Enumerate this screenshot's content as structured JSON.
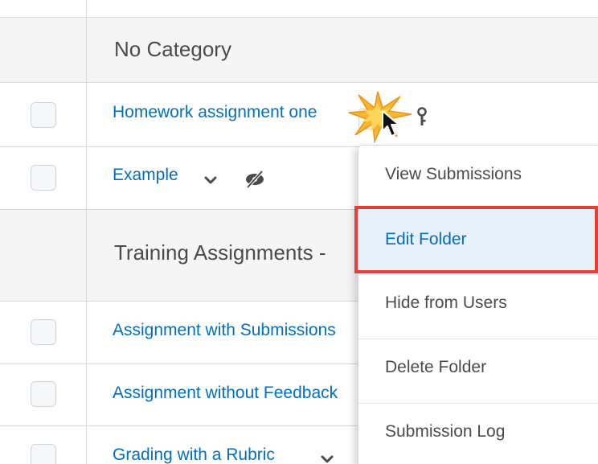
{
  "categories": [
    {
      "title": "No Category"
    },
    {
      "title": "Training Assignments - "
    }
  ],
  "rows": [
    {
      "label": "Homework assignment one"
    },
    {
      "label": "Example"
    },
    {
      "label": "Assignment with Submissions"
    },
    {
      "label": "Assignment without Feedback"
    },
    {
      "label": "Grading with a Rubric"
    }
  ],
  "context_menu": {
    "items": [
      {
        "label": "View Submissions"
      },
      {
        "label": "Edit Folder"
      },
      {
        "label": "Hide from Users"
      },
      {
        "label": "Delete Folder"
      },
      {
        "label": "Submission Log"
      }
    ],
    "highlighted_item": "Edit Folder"
  },
  "icons": {
    "row_dropdown": "chevron-down-icon",
    "restriction": "key-icon",
    "hidden": "eye-slash-icon",
    "cursor": "mouse-pointer-icon"
  },
  "colors": {
    "link": "#006fbf",
    "highlight_border": "#e0403a",
    "active_item_bg": "#e8f1fa",
    "category_bg": "#f5f5f6"
  }
}
